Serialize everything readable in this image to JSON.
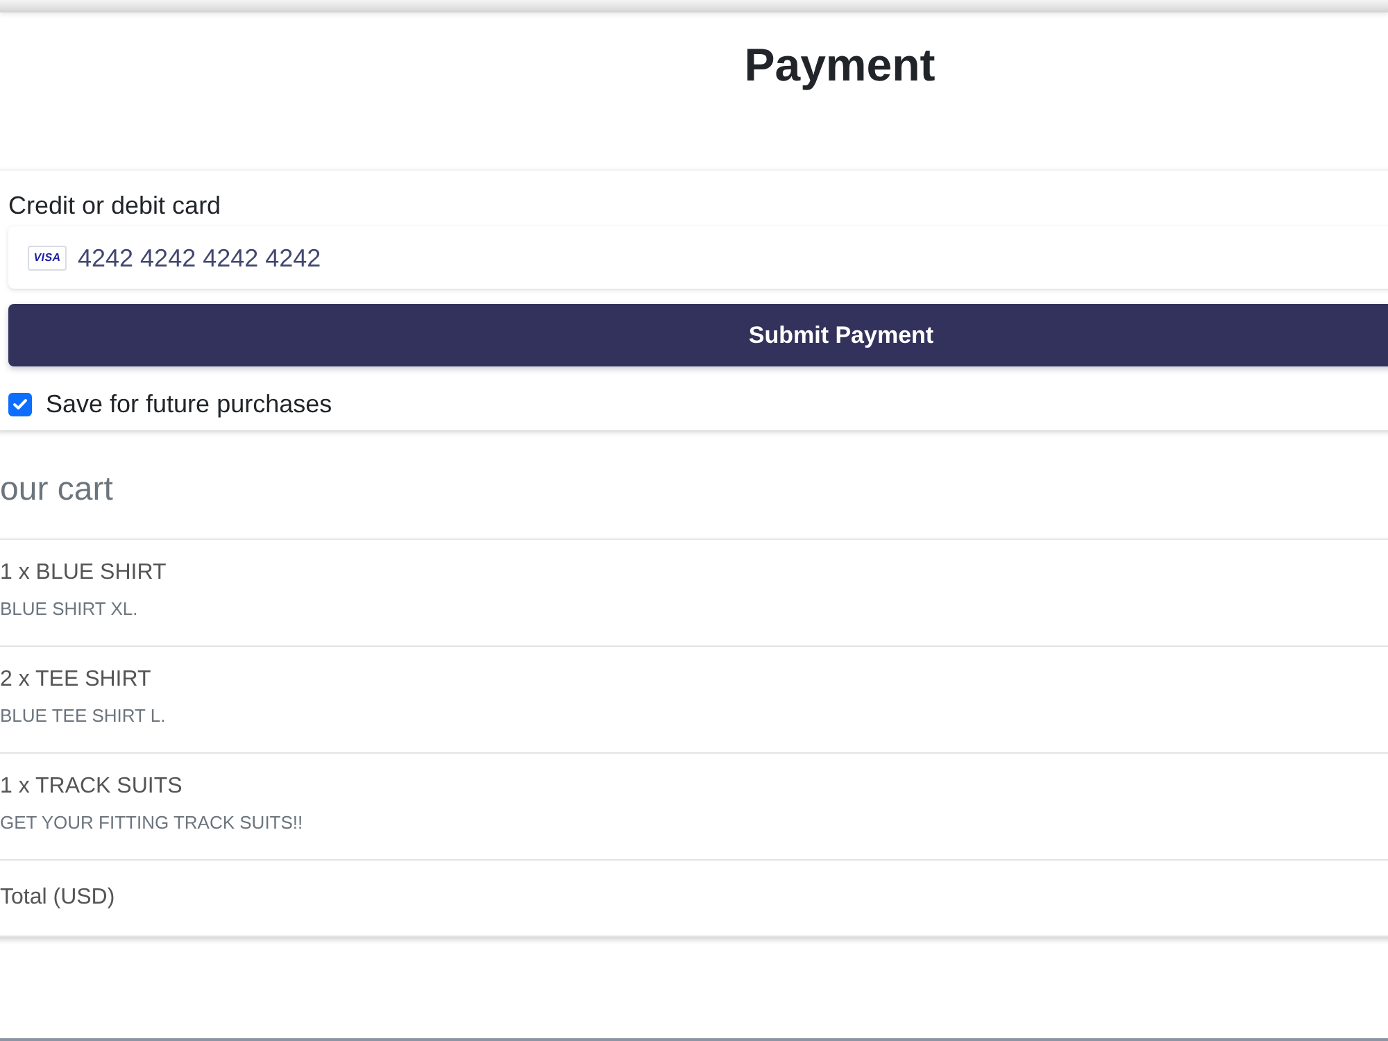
{
  "page": {
    "title": "Payment"
  },
  "payment_form": {
    "card_label": "Credit or debit card",
    "card_field": {
      "brand": "VISA",
      "value": "4242 4242 4242 4242"
    },
    "submit_button": "Submit Payment",
    "save_option": {
      "label": "Save for future purchases",
      "checked": true
    }
  },
  "cart": {
    "heading": "our cart",
    "items": [
      {
        "name": "1 x BLUE SHIRT",
        "description": "BLUE SHIRT XL."
      },
      {
        "name": "2 x TEE SHIRT",
        "description": "BLUE TEE SHIRT L."
      },
      {
        "name": "1 x TRACK SUITS",
        "description": "GET YOUR FITTING TRACK SUITS!!"
      }
    ],
    "total_label": "Total (USD)"
  }
}
